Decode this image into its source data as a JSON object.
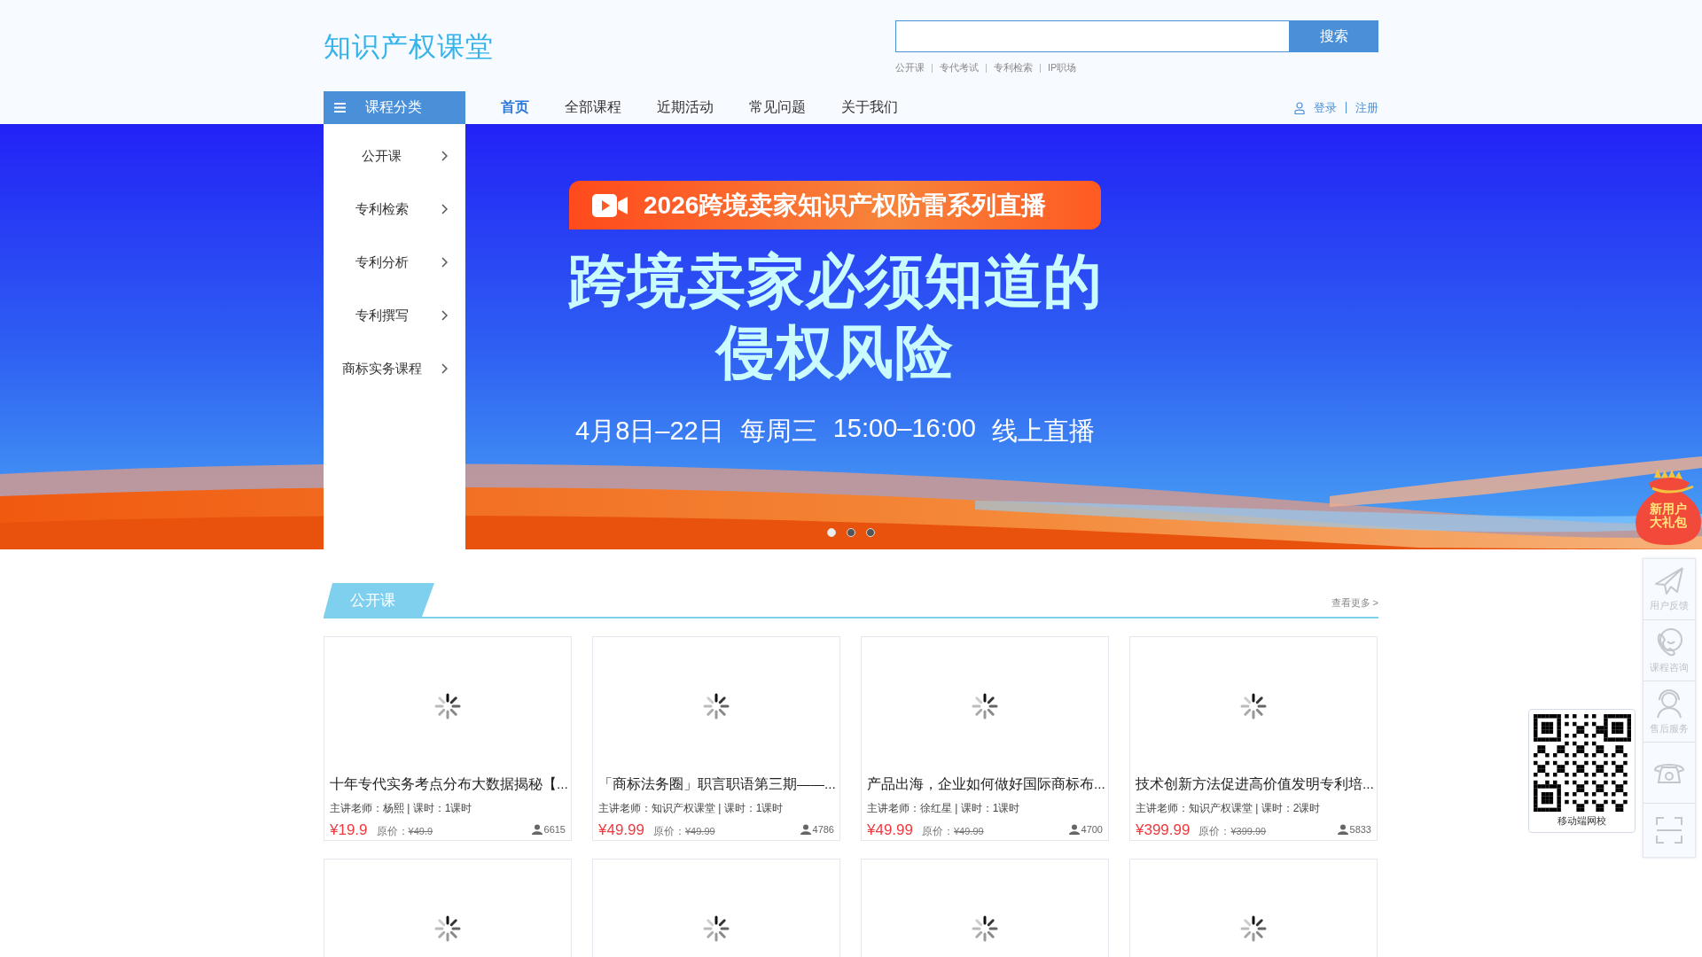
{
  "header": {
    "logo": "知识产权课堂",
    "search": {
      "button": "搜索",
      "hot_links": [
        "公开课",
        "专代考试",
        "专利检索",
        "IP职场"
      ]
    }
  },
  "nav": {
    "category_button": "课程分类",
    "items": [
      {
        "label": "首页",
        "selected": true
      },
      {
        "label": "全部课程",
        "selected": false
      },
      {
        "label": "近期活动",
        "selected": false
      },
      {
        "label": "常见问题",
        "selected": false
      },
      {
        "label": "关于我们",
        "selected": false
      }
    ],
    "login": "登录",
    "register": "注册"
  },
  "sidebar": {
    "items": [
      "公开课",
      "专利检索",
      "专利分析",
      "专利撰写",
      "商标实务课程"
    ]
  },
  "banner": {
    "tag": "2026跨境卖家知识产权防雷系列直播",
    "title_lines": [
      "跨境卖家必须知道的",
      "侵权风险"
    ],
    "schedule": [
      "4月8日–22日",
      "每周三",
      "15:00–16:00",
      "线上直播"
    ],
    "dots": [
      {
        "selected": true
      },
      {
        "selected": false
      },
      {
        "selected": false
      }
    ]
  },
  "gift_badge": [
    "新用户",
    "大礼包"
  ],
  "section": {
    "title": "公开课",
    "more": "查看更多 >",
    "cards": [
      {
        "kind": "course",
        "title": "十年专代实务考点分布大数据揭秘【...",
        "teacher_line": "主讲老师：杨熙 | 课时：1课时",
        "price": "¥19.9",
        "original_label": "原价：",
        "original_price": "¥49.9",
        "students": "6615"
      },
      {
        "kind": "course",
        "title": "「商标法务圈」职言职语第三期——...",
        "teacher_line": "主讲老师：知识产权课堂 | 课时：1课时",
        "price": "¥49.99",
        "original_label": "原价：",
        "original_price": "¥49.99",
        "students": "4786"
      },
      {
        "kind": "course",
        "title": "产品出海，企业如何做好国际商标布...",
        "teacher_line": "主讲老师：徐红星 | 课时：1课时",
        "price": "¥49.99",
        "original_label": "原价：",
        "original_price": "¥49.99",
        "students": "4700"
      },
      {
        "kind": "course",
        "title": "技术创新方法促进高价值发明专利培...",
        "teacher_line": "主讲老师：知识产权课堂 | 课时：2课时",
        "price": "¥399.99",
        "original_label": "原价：",
        "original_price": "¥399.99",
        "students": "5833"
      },
      {
        "kind": "loading"
      },
      {
        "kind": "loading"
      },
      {
        "kind": "loading"
      },
      {
        "kind": "loading"
      }
    ]
  },
  "float_tools": {
    "items": [
      {
        "kind": "feedback",
        "label": "用户反馈"
      },
      {
        "kind": "consult",
        "label": "课程咨询"
      },
      {
        "kind": "service",
        "label": "售后服务"
      },
      {
        "kind": "phone"
      },
      {
        "kind": "scan"
      }
    ],
    "qr_caption": "移动端网校"
  }
}
